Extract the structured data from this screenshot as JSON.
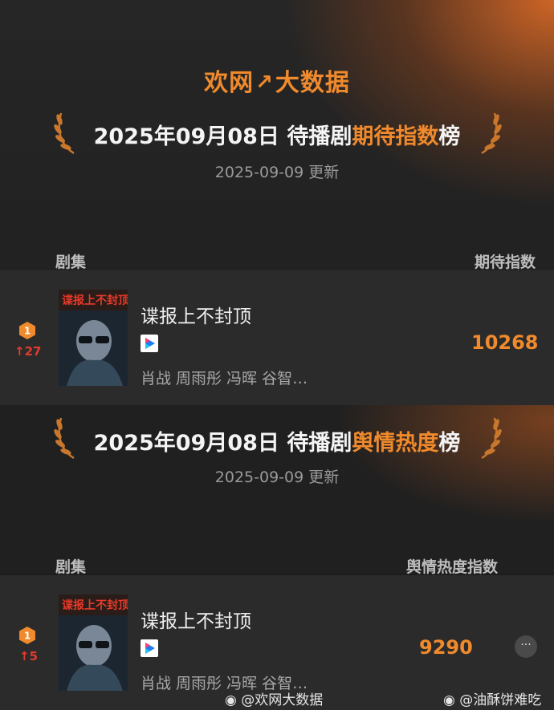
{
  "brand": {
    "part1": "欢网",
    "arrow": "↗",
    "part2": "大数据"
  },
  "board1": {
    "title_prefix": "2025年09月08日 待播剧",
    "title_highlight": "期待指数",
    "title_suffix": "榜",
    "updated": "2025-09-09 更新",
    "col_left": "剧集",
    "col_right": "期待指数",
    "row": {
      "rank": "1",
      "change": "↑27",
      "name": "谍报上不封顶",
      "cast": "肖战 周雨彤 冯晖 谷智…",
      "score": "10268",
      "platform_icon": "youku-icon"
    }
  },
  "board2": {
    "title_prefix": "2025年09月08日 待播剧",
    "title_highlight": "舆情热度",
    "title_suffix": "榜",
    "updated": "2025-09-09 更新",
    "col_left": "剧集",
    "col_right": "舆情热度指数",
    "row": {
      "rank": "1",
      "change": "↑5",
      "name": "谍报上不封顶",
      "cast": "肖战 周雨彤 冯晖 谷智…",
      "score": "9290",
      "platform_icon": "youku-icon"
    }
  },
  "more_label": "···",
  "watermarks": {
    "left": "@欢网大数据",
    "right": "@油酥饼难吃"
  },
  "colors": {
    "accent": "#f08a2c",
    "rise": "#e23b2e",
    "background": "#1d1d1d",
    "row": "#2b2b2b"
  }
}
